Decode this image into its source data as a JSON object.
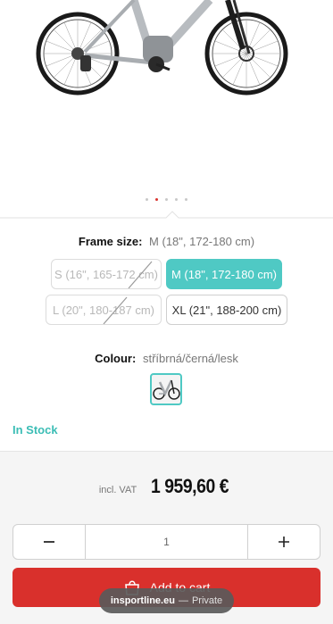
{
  "hero": {
    "image_alt": "electric mountain bike",
    "carousel_dots": 5,
    "carousel_active_index": 1
  },
  "frame": {
    "label": "Frame size:",
    "selected_value": "M (18\", 172-180 cm)",
    "options": [
      {
        "label": "S (16\", 165-172 cm)",
        "available": false,
        "selected": false
      },
      {
        "label": "M (18\", 172-180 cm)",
        "available": true,
        "selected": true
      },
      {
        "label": "L (20\", 180-187 cm)",
        "available": false,
        "selected": false
      },
      {
        "label": "XL (21\", 188-200 cm)",
        "available": true,
        "selected": false
      }
    ]
  },
  "colour": {
    "label": "Colour:",
    "value": "stříbrná/černá/lesk"
  },
  "stock": {
    "text": "In Stock",
    "color": "#3bbdb5"
  },
  "price": {
    "vat_label": "incl. VAT",
    "amount": "1 959,60 €"
  },
  "quantity": {
    "value": "1",
    "minus_icon": "minus-icon",
    "plus_icon": "plus-icon"
  },
  "cart": {
    "label": "Add to cart",
    "icon": "shopping-bag-icon",
    "color": "#d9302c"
  },
  "browser": {
    "domain": "insportline.eu",
    "separator": "—",
    "mode": "Private"
  },
  "colors": {
    "accent": "#4fc9c4",
    "brand_red": "#d9302c"
  }
}
